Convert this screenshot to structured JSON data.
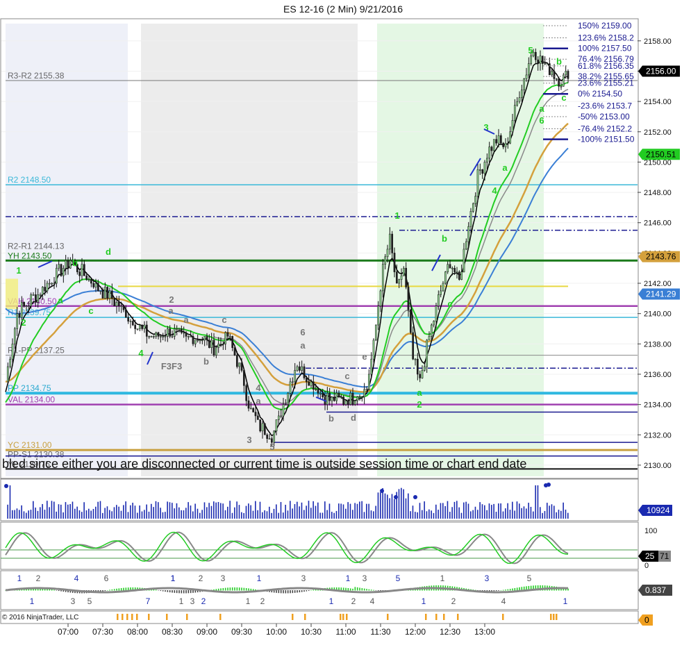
{
  "window": {
    "title": "ES 12-16 (2 Min)  9/21/2016",
    "copyright": "© 2016 NinjaTrader, LLC",
    "message": "bled since either you are disconnected or current time is outside session time or chart end date"
  },
  "colors": {
    "up_bar": "#8fce8f",
    "down_bar": "#222222",
    "ema_black": "#000000",
    "ema_gray": "#8a8a8a",
    "ema_green": "#22cc22",
    "ema_gold": "#d4a03c",
    "ema_blue": "#3a7fd5",
    "r2": "#39b8d8",
    "yh": "#1a7a1a",
    "vah": "#a040b0",
    "val": "#a040b0",
    "yc": "#c8a040",
    "navy": "#1a1a90",
    "label_gray": "#666666",
    "green_label": "#22cc22",
    "shade_gray": "#ececec",
    "shade_blue": "#eef0f8",
    "shade_green": "#e4f7e4"
  },
  "chart_data": [
    {
      "type": "candlestick",
      "title": "ES 12-16 (2 Min)  9/21/2016",
      "x_ticks": [
        "07:00",
        "07:30",
        "08:00",
        "08:30",
        "09:00",
        "09:30",
        "10:00",
        "10:30",
        "11:00",
        "11:30",
        "12:00",
        "12:30",
        "13:00"
      ],
      "ylim": [
        2129,
        2160
      ],
      "y_ticks": [
        2130.0,
        2132.0,
        2134.0,
        2136.0,
        2138.0,
        2140.0,
        2142.0,
        2144.0,
        2146.0,
        2148.0,
        2150.0,
        2152.0,
        2154.0,
        2156.0,
        2158.0
      ],
      "y_tick_labels": [
        "2130.00",
        "2132.00",
        "2134.00",
        "2136.00",
        "2138.00",
        "2140.00",
        "2142.00",
        "2144.00",
        "2146.00",
        "2148.00",
        "2150.00",
        "2152.00",
        "2154.00",
        "2156.00",
        "2158.00"
      ],
      "close_path": [
        [
          0,
          2135.5
        ],
        [
          5,
          2140.0
        ],
        [
          15,
          2141.5
        ],
        [
          28,
          2143.5
        ],
        [
          38,
          2142.0
        ],
        [
          46,
          2141.0
        ],
        [
          52,
          2140.0
        ],
        [
          58,
          2139.0
        ],
        [
          64,
          2138.5
        ],
        [
          72,
          2138.75
        ],
        [
          78,
          2138.25
        ],
        [
          84,
          2138.5
        ],
        [
          90,
          2137.75
        ],
        [
          96,
          2138.5
        ],
        [
          102,
          2136.0
        ],
        [
          106,
          2133.5
        ],
        [
          110,
          2132.5
        ],
        [
          115,
          2132.0
        ],
        [
          118,
          2133.0
        ],
        [
          122,
          2135.0
        ],
        [
          126,
          2136.75
        ],
        [
          132,
          2135.5
        ],
        [
          138,
          2134.5
        ],
        [
          144,
          2134.25
        ],
        [
          150,
          2134.5
        ],
        [
          156,
          2135.0
        ],
        [
          159,
          2138.0
        ],
        [
          163,
          2143.0
        ],
        [
          166,
          2145.0
        ],
        [
          169,
          2141.5
        ],
        [
          172,
          2143.0
        ],
        [
          176,
          2137.0
        ],
        [
          179,
          2135.5
        ],
        [
          183,
          2138.5
        ],
        [
          188,
          2141.5
        ],
        [
          192,
          2143.5
        ],
        [
          196,
          2142.0
        ],
        [
          200,
          2146.0
        ],
        [
          204,
          2149.0
        ],
        [
          208,
          2150.5
        ],
        [
          212,
          2151.5
        ],
        [
          216,
          2151.0
        ],
        [
          220,
          2153.5
        ],
        [
          224,
          2155.5
        ],
        [
          228,
          2157.5
        ],
        [
          232,
          2156.5
        ],
        [
          236,
          2156.0
        ],
        [
          240,
          2155.25
        ],
        [
          243,
          2156.0
        ]
      ],
      "current_price": "2156.00",
      "ema_values": [
        {
          "name": "ema_black",
          "last": "2156.00"
        },
        {
          "name": "ema_green",
          "last": "2150.51"
        },
        {
          "name": "ema_gold",
          "last": "2143.76"
        },
        {
          "name": "ema_blue",
          "last": "2141.29"
        }
      ],
      "price_levels": [
        {
          "label": "R3-R2 2155.38",
          "value": 2155.38
        },
        {
          "label": "R2 2148.50",
          "value": 2148.5
        },
        {
          "label": "R2-R1 2144.13",
          "value": 2144.13
        },
        {
          "label": "YH 2143.50",
          "value": 2143.5
        },
        {
          "label": "VAH 2140.50",
          "value": 2140.5
        },
        {
          "label": "R1 2139.75",
          "value": 2139.75
        },
        {
          "label": "R1-PP 2137.25",
          "value": 2137.25
        },
        {
          "label": "PP 2134.75",
          "value": 2134.75
        },
        {
          "label": "VAL 2134.00",
          "value": 2134.0
        },
        {
          "label": "YC 2131.00",
          "value": 2131.0
        },
        {
          "label": "PP-S1 2130.38",
          "value": 2130.38
        },
        {
          "label": "YL 2129.75",
          "value": 2129.75
        }
      ],
      "fib_levels": [
        {
          "label": "150%  2159.00",
          "value": 2159.0
        },
        {
          "label": "123.6%  2158.2",
          "value": 2158.2
        },
        {
          "label": "100%  2157.50",
          "value": 2157.5
        },
        {
          "label": "76.4%  2156.79",
          "value": 2156.79
        },
        {
          "label": "61.8%  2156.35",
          "value": 2156.35
        },
        {
          "label": "38.2%  2155.65",
          "value": 2155.65
        },
        {
          "label": "23.6%  2155.21",
          "value": 2155.21
        },
        {
          "label": "0%  2154.50",
          "value": 2154.5
        },
        {
          "label": "-23.6%  2153.7",
          "value": 2153.7
        },
        {
          "label": "-50%  2153.00",
          "value": 2153.0
        },
        {
          "label": "-76.4%  2152.2",
          "value": 2152.2
        },
        {
          "label": "-100%  2151.50",
          "value": 2151.5
        }
      ],
      "wave_labels": [
        "1",
        "a",
        "2",
        "b",
        "c",
        "d",
        "4",
        "2",
        "a",
        "a",
        "b",
        "c",
        "F3F3",
        "3",
        "4",
        "a",
        "5",
        "6",
        "a",
        "b",
        "c",
        "d",
        "e",
        "1",
        "b",
        "c",
        "a",
        "2",
        "3",
        "a",
        "4",
        "5",
        "b",
        "a",
        "c",
        "6"
      ]
    },
    {
      "type": "bar",
      "name": "volume",
      "last_value": "10924"
    },
    {
      "type": "line",
      "name": "stochastics",
      "y_ticks": [
        "100",
        "0"
      ],
      "values_readout": [
        "25",
        "71"
      ]
    },
    {
      "type": "bar",
      "name": "macd",
      "wave_counts_top": [
        "1",
        "2",
        "4",
        "6",
        "1",
        "2",
        "1",
        "3",
        "1",
        "3",
        "1",
        "3",
        "5",
        "1",
        "3",
        "5"
      ],
      "wave_counts_bottom": [
        "1",
        "3",
        "5",
        "7",
        "1",
        "3",
        "2",
        "1",
        "2",
        "1",
        "2",
        "4",
        "1",
        "2",
        "4",
        "1"
      ],
      "last_value": "0.837"
    },
    {
      "type": "bar",
      "name": "signal",
      "last_value": "0"
    }
  ]
}
